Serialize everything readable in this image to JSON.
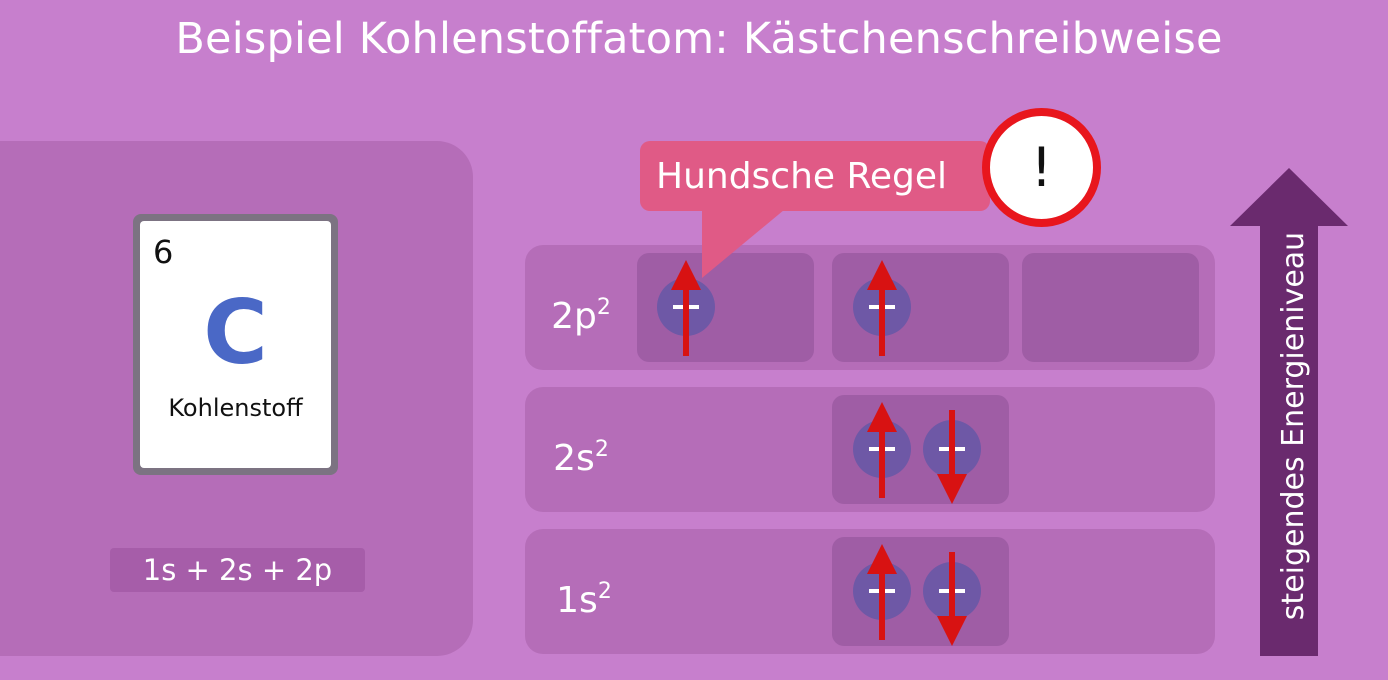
{
  "title": "Beispiel Kohlenstoffatom: Kästchenschreibweise",
  "element": {
    "number": "6",
    "symbol": "C",
    "name": "Kohlenstoff"
  },
  "configuration": "1s + 2s + 2p",
  "levels": {
    "p2": {
      "label": "2p",
      "superscript": "2"
    },
    "s2": {
      "label": "2s",
      "superscript": "2"
    },
    "s1": {
      "label": "1s",
      "superscript": "2"
    }
  },
  "callout": {
    "text": "Hundsche Regel",
    "alert_symbol": "!"
  },
  "energy_axis": {
    "label": "steigendes Energieniveau"
  },
  "colors": {
    "background": "#c77fcd",
    "panel": "#b56db8",
    "box": "#9f5da5",
    "electron": "#6e58a6",
    "spin_arrow": "#d81212",
    "callout": "#e05a86",
    "energy_arrow": "#6a2a6e",
    "element_symbol": "#4a68c6"
  },
  "icons": {
    "spin_up": "arrow-up-icon",
    "spin_down": "arrow-down-icon",
    "alert": "exclamation-icon"
  }
}
